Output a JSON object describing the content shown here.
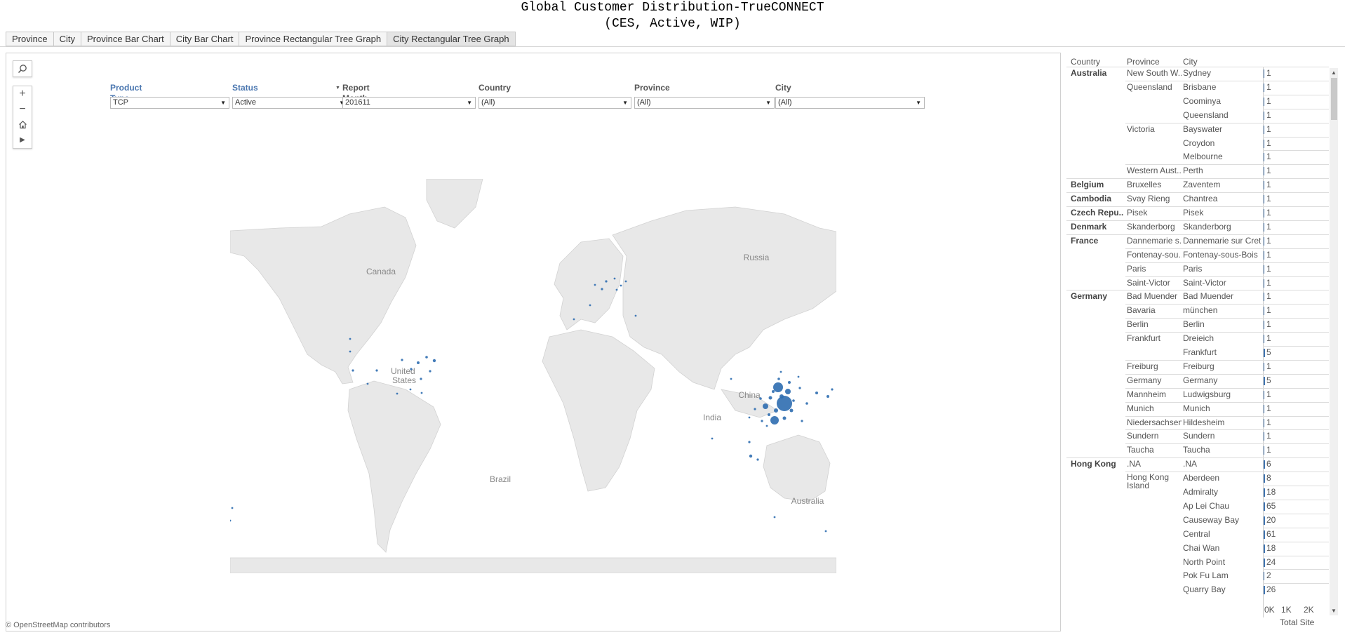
{
  "title": {
    "line1": "Global Customer Distribution-TrueCONNECT",
    "line2": "(CES, Active, WIP)"
  },
  "tabs": [
    "Province",
    "City",
    "Province Bar Chart",
    "City Bar Chart",
    "Province Rectangular Tree Graph",
    "City Rectangular Tree Graph"
  ],
  "active_tab": "City Rectangular Tree Graph",
  "filters": {
    "product_type": {
      "label": "Product Type",
      "value": "TCP"
    },
    "status": {
      "label": "Status",
      "value": "Active"
    },
    "report_month": {
      "label": "Report Month",
      "value": "201611"
    },
    "country": {
      "label": "Country",
      "value": "(All)"
    },
    "province": {
      "label": "Province",
      "value": "(All)"
    },
    "city": {
      "label": "City",
      "value": "(All)"
    }
  },
  "map": {
    "labels": {
      "canada": "Canada",
      "united_states": "United\nStates",
      "russia": "Russia",
      "china": "China",
      "india": "India",
      "brazil": "Brazil",
      "australia": "Australia"
    },
    "credit": "© OpenStreetMap contributors",
    "land_color": "#e8e8e8",
    "ocean_color": "#ffffff",
    "point_color": "#2e6db0"
  },
  "table": {
    "headers": {
      "country": "Country",
      "province": "Province",
      "city": "City"
    },
    "rows": [
      {
        "country": "Australia",
        "province": "New South W..",
        "city": "Sydney",
        "value": "1"
      },
      {
        "country": "",
        "province": "Queensland",
        "city": "Brisbane",
        "value": "1"
      },
      {
        "country": "",
        "province": "",
        "city": "Coominya",
        "value": "1"
      },
      {
        "country": "",
        "province": "",
        "city": "Queensland",
        "value": "1"
      },
      {
        "country": "",
        "province": "Victoria",
        "city": "Bayswater",
        "value": "1"
      },
      {
        "country": "",
        "province": "",
        "city": "Croydon",
        "value": "1"
      },
      {
        "country": "",
        "province": "",
        "city": "Melbourne",
        "value": "1"
      },
      {
        "country": "",
        "province": "Western Aust..",
        "city": "Perth",
        "value": "1"
      },
      {
        "country": "Belgium",
        "province": "Bruxelles",
        "city": "Zaventem",
        "value": "1"
      },
      {
        "country": "Cambodia",
        "province": "Svay Rieng",
        "city": "Chantrea",
        "value": "1"
      },
      {
        "country": "Czech Repu..",
        "province": "Pisek",
        "city": "Pisek",
        "value": "1"
      },
      {
        "country": "Denmark",
        "province": "Skanderborg",
        "city": "Skanderborg",
        "value": "1"
      },
      {
        "country": "France",
        "province": "Dannemarie s..",
        "city": "Dannemarie sur Crete",
        "value": "1"
      },
      {
        "country": "",
        "province": "Fontenay-sou..",
        "city": "Fontenay-sous-Bois",
        "value": "1"
      },
      {
        "country": "",
        "province": "Paris",
        "city": "Paris",
        "value": "1"
      },
      {
        "country": "",
        "province": "Saint-Victor",
        "city": "Saint-Victor",
        "value": "1"
      },
      {
        "country": "Germany",
        "province": "Bad Muender",
        "city": "Bad Muender",
        "value": "1"
      },
      {
        "country": "",
        "province": "Bavaria",
        "city": "münchen",
        "value": "1"
      },
      {
        "country": "",
        "province": "Berlin",
        "city": "Berlin",
        "value": "1"
      },
      {
        "country": "",
        "province": "Frankfurt",
        "city": "Dreieich",
        "value": "1"
      },
      {
        "country": "",
        "province": "",
        "city": "Frankfurt",
        "value": "5"
      },
      {
        "country": "",
        "province": "Freiburg",
        "city": "Freiburg",
        "value": "1"
      },
      {
        "country": "",
        "province": "Germany",
        "city": "Germany",
        "value": "5"
      },
      {
        "country": "",
        "province": "Mannheim",
        "city": "Ludwigsburg",
        "value": "1"
      },
      {
        "country": "",
        "province": "Munich",
        "city": "Munich",
        "value": "1"
      },
      {
        "country": "",
        "province": "Niedersachsen",
        "city": "Hildesheim",
        "value": "1"
      },
      {
        "country": "",
        "province": "Sundern",
        "city": "Sundern",
        "value": "1"
      },
      {
        "country": "",
        "province": "Taucha",
        "city": "Taucha",
        "value": "1"
      },
      {
        "country": "Hong Kong",
        "province": ".NA",
        "city": ".NA",
        "value": "6"
      },
      {
        "country": "",
        "province": "Hong Kong Island",
        "city": "Aberdeen",
        "value": "8"
      },
      {
        "country": "",
        "province": "",
        "city": "Admiralty",
        "value": "18"
      },
      {
        "country": "",
        "province": "",
        "city": "Ap Lei Chau",
        "value": "65"
      },
      {
        "country": "",
        "province": "",
        "city": "Causeway Bay",
        "value": "20"
      },
      {
        "country": "",
        "province": "",
        "city": "Central",
        "value": "61"
      },
      {
        "country": "",
        "province": "",
        "city": "Chai Wan",
        "value": "18"
      },
      {
        "country": "",
        "province": "",
        "city": "North Point",
        "value": "24"
      },
      {
        "country": "",
        "province": "",
        "city": "Pok Fu Lam",
        "value": "2"
      },
      {
        "country": "",
        "province": "",
        "city": "Quarry Bay",
        "value": "26"
      }
    ],
    "axis": {
      "ticks": [
        "0K",
        "1K",
        "2K"
      ],
      "max": 2000,
      "label": "Total Site"
    }
  }
}
